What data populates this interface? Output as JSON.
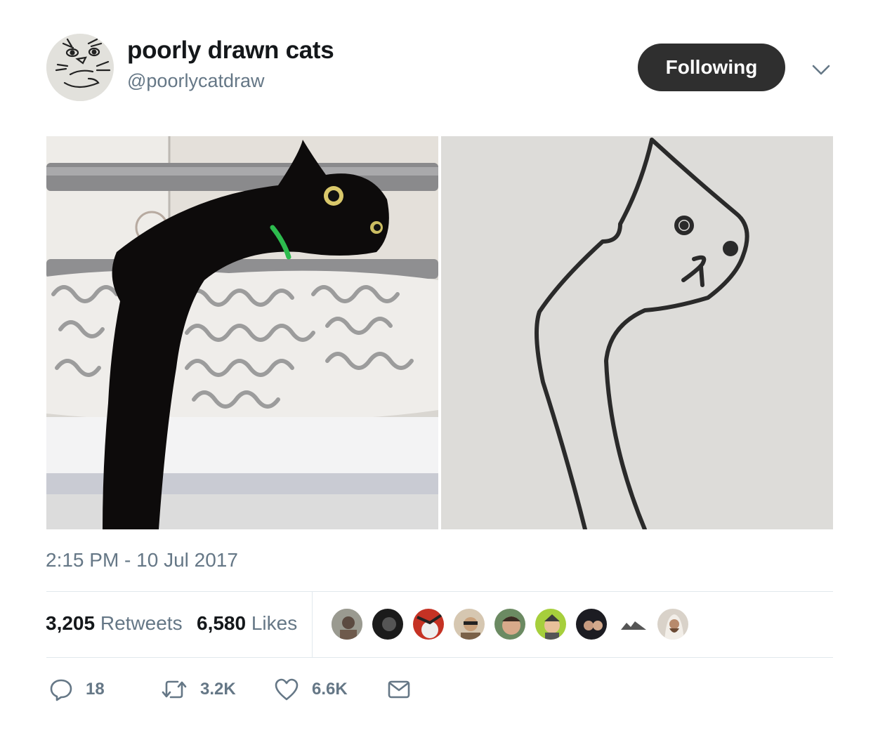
{
  "author": {
    "display_name": "poorly drawn cats",
    "handle": "@poorlycatdraw",
    "avatar_icon": "cat-drawing-avatar"
  },
  "follow_button": {
    "label": "Following"
  },
  "more_menu_icon": "chevron-down-icon",
  "media": [
    {
      "name": "photo-black-cat-on-bed",
      "kind": "photo"
    },
    {
      "name": "drawing-long-neck-cat",
      "kind": "drawing"
    }
  ],
  "timestamp": "2:15 PM - 10 Jul 2017",
  "stats": {
    "retweets_count": "3,205",
    "retweets_label": "Retweets",
    "likes_count": "6,580",
    "likes_label": "Likes"
  },
  "likers_count_shown": 9,
  "actions": {
    "reply_icon": "reply-icon",
    "reply_count": "18",
    "retweet_icon": "retweet-icon",
    "retweet_count": "3.2K",
    "like_icon": "heart-icon",
    "like_count": "6.6K",
    "dm_icon": "envelope-icon"
  },
  "colors": {
    "button_bg": "#2f2f2f",
    "secondary_text": "#657786",
    "divider": "#e1e8ed"
  }
}
